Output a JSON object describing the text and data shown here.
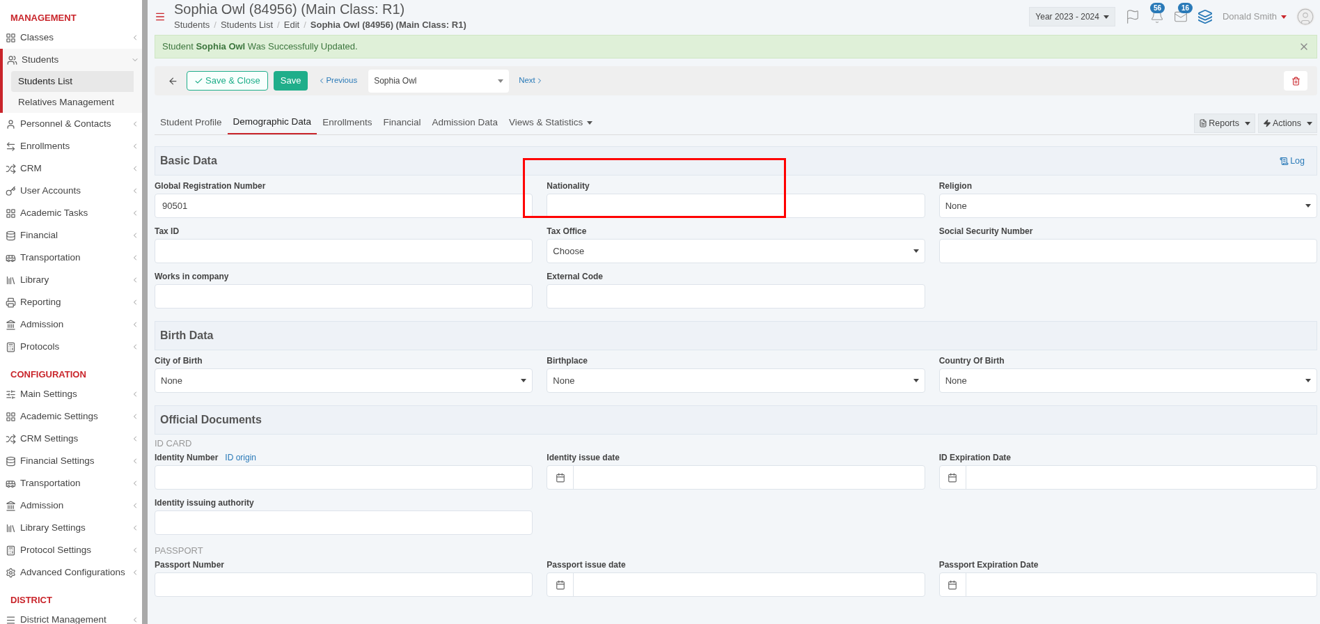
{
  "sidebar": {
    "sections": [
      {
        "title": "MANAGEMENT",
        "items": [
          {
            "label": "Classes",
            "selected": false,
            "expanded": false
          },
          {
            "label": "Students",
            "selected": true,
            "expanded": true,
            "children": [
              {
                "label": "Students List",
                "selected": true
              },
              {
                "label": "Relatives Management",
                "selected": false
              }
            ]
          },
          {
            "label": "Personnel & Contacts",
            "selected": false,
            "expanded": false
          },
          {
            "label": "Enrollments",
            "selected": false,
            "expanded": false
          },
          {
            "label": "CRM",
            "selected": false,
            "expanded": false
          },
          {
            "label": "User Accounts",
            "selected": false,
            "expanded": false
          },
          {
            "label": "Academic Tasks",
            "selected": false,
            "expanded": false
          },
          {
            "label": "Financial",
            "selected": false,
            "expanded": false
          },
          {
            "label": "Transportation",
            "selected": false,
            "expanded": false
          },
          {
            "label": "Library",
            "selected": false,
            "expanded": false
          },
          {
            "label": "Reporting",
            "selected": false,
            "expanded": false
          },
          {
            "label": "Admission",
            "selected": false,
            "expanded": false
          },
          {
            "label": "Protocols",
            "selected": false,
            "expanded": false
          }
        ]
      },
      {
        "title": "CONFIGURATION",
        "items": [
          {
            "label": "Main Settings",
            "selected": false,
            "expanded": false
          },
          {
            "label": "Academic Settings",
            "selected": false,
            "expanded": false
          },
          {
            "label": "CRM Settings",
            "selected": false,
            "expanded": false
          },
          {
            "label": "Financial Settings",
            "selected": false,
            "expanded": false
          },
          {
            "label": "Transportation",
            "selected": false,
            "expanded": false
          },
          {
            "label": "Admission",
            "selected": false,
            "expanded": false
          },
          {
            "label": "Library Settings",
            "selected": false,
            "expanded": false
          },
          {
            "label": "Protocol Settings",
            "selected": false,
            "expanded": false
          },
          {
            "label": "Advanced Configurations",
            "selected": false,
            "expanded": false
          }
        ]
      },
      {
        "title": "DISTRICT",
        "items": [
          {
            "label": "District Management",
            "selected": false,
            "expanded": false
          }
        ]
      }
    ]
  },
  "header": {
    "title": "Sophia Owl (84956) (Main Class: R1)",
    "breadcrumb_separator": "/",
    "breadcrumb": [
      "Students",
      "Students List",
      "Edit",
      "Sophia Owl (84956) (Main Class: R1)"
    ],
    "year": "Year 2023 - 2024",
    "notifications": "56",
    "messages": "16",
    "user": "Donald Smith"
  },
  "alert": {
    "text": "Student **Sophia Owl** Was Successfully Updated."
  },
  "toolbar": {
    "save_close": "Save & Close",
    "save": "Save",
    "previous": "Previous",
    "student": "Sophia Owl",
    "next": "Next"
  },
  "tabs": [
    {
      "label": "Student Profile",
      "selected": false,
      "dropdown": false
    },
    {
      "label": "Demographic Data",
      "selected": true,
      "dropdown": false
    },
    {
      "label": "Enrollments",
      "selected": false,
      "dropdown": false
    },
    {
      "label": "Financial",
      "selected": false,
      "dropdown": false
    },
    {
      "label": "Admission Data",
      "selected": false,
      "dropdown": false
    },
    {
      "label": "Views & Statistics",
      "selected": false,
      "dropdown": true
    }
  ],
  "tab_actions": [
    "Reports",
    "Actions"
  ],
  "sections": [
    {
      "title": "Basic Data",
      "log": "Log",
      "groups": [
        {
          "fields": [
            {
              "label": "Global Registration Number",
              "kind": "text",
              "value": "90501"
            },
            {
              "label": "Nationality",
              "kind": "text",
              "highlighted": true
            },
            {
              "label": "Religion",
              "kind": "select",
              "value": "None"
            },
            {
              "label": "Tax ID",
              "kind": "text"
            },
            {
              "label": "Tax Office",
              "kind": "select",
              "value": "Choose"
            },
            {
              "label": "Social Security Number",
              "kind": "text"
            },
            {
              "label": "Works in company",
              "kind": "text"
            },
            {
              "label": "External Code",
              "kind": "text"
            }
          ]
        }
      ]
    },
    {
      "title": "Birth Data",
      "groups": [
        {
          "fields": [
            {
              "label": "City of Birth",
              "kind": "select",
              "value": "None"
            },
            {
              "label": "Birthplace",
              "kind": "select",
              "value": "None"
            },
            {
              "label": "Country Of Birth",
              "kind": "select",
              "value": "None"
            }
          ]
        }
      ]
    },
    {
      "title": "Official Documents",
      "groups": [
        {
          "caption": "ID CARD",
          "fields": [
            {
              "label": "Identity Number",
              "kind": "text",
              "link": "ID origin"
            },
            {
              "label": "Identity issue date",
              "kind": "date"
            },
            {
              "label": "ID Expiration Date",
              "kind": "date"
            },
            {
              "label": "Identity issuing authority",
              "kind": "text"
            }
          ]
        },
        {
          "caption": "PASSPORT",
          "fields": [
            {
              "label": "Passport Number",
              "kind": "text"
            },
            {
              "label": "Passport issue date",
              "kind": "date"
            },
            {
              "label": "Passport Expiration Date",
              "kind": "date"
            }
          ]
        }
      ]
    }
  ]
}
